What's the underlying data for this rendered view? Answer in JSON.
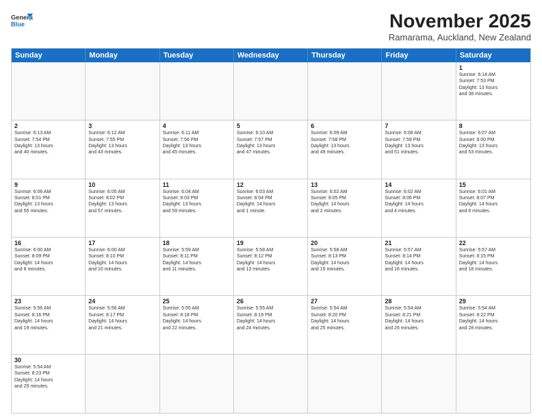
{
  "header": {
    "logo_general": "General",
    "logo_blue": "Blue",
    "month_title": "November 2025",
    "subtitle": "Ramarama, Auckland, New Zealand"
  },
  "weekdays": [
    "Sunday",
    "Monday",
    "Tuesday",
    "Wednesday",
    "Thursday",
    "Friday",
    "Saturday"
  ],
  "weeks": [
    [
      {
        "day": "",
        "text": ""
      },
      {
        "day": "",
        "text": ""
      },
      {
        "day": "",
        "text": ""
      },
      {
        "day": "",
        "text": ""
      },
      {
        "day": "",
        "text": ""
      },
      {
        "day": "",
        "text": ""
      },
      {
        "day": "1",
        "text": "Sunrise: 6:14 AM\nSunset: 7:53 PM\nDaylight: 13 hours\nand 38 minutes."
      }
    ],
    [
      {
        "day": "2",
        "text": "Sunrise: 6:13 AM\nSunset: 7:54 PM\nDaylight: 13 hours\nand 40 minutes."
      },
      {
        "day": "3",
        "text": "Sunrise: 6:12 AM\nSunset: 7:55 PM\nDaylight: 13 hours\nand 43 minutes."
      },
      {
        "day": "4",
        "text": "Sunrise: 6:11 AM\nSunset: 7:56 PM\nDaylight: 13 hours\nand 45 minutes."
      },
      {
        "day": "5",
        "text": "Sunrise: 6:10 AM\nSunset: 7:57 PM\nDaylight: 13 hours\nand 47 minutes."
      },
      {
        "day": "6",
        "text": "Sunrise: 6:09 AM\nSunset: 7:58 PM\nDaylight: 13 hours\nand 49 minutes."
      },
      {
        "day": "7",
        "text": "Sunrise: 6:08 AM\nSunset: 7:59 PM\nDaylight: 13 hours\nand 51 minutes."
      },
      {
        "day": "8",
        "text": "Sunrise: 6:07 AM\nSunset: 8:00 PM\nDaylight: 13 hours\nand 53 minutes."
      }
    ],
    [
      {
        "day": "9",
        "text": "Sunrise: 6:06 AM\nSunset: 8:01 PM\nDaylight: 13 hours\nand 55 minutes."
      },
      {
        "day": "10",
        "text": "Sunrise: 6:05 AM\nSunset: 8:02 PM\nDaylight: 13 hours\nand 57 minutes."
      },
      {
        "day": "11",
        "text": "Sunrise: 6:04 AM\nSunset: 8:03 PM\nDaylight: 13 hours\nand 59 minutes."
      },
      {
        "day": "12",
        "text": "Sunrise: 6:03 AM\nSunset: 8:04 PM\nDaylight: 14 hours\nand 1 minute."
      },
      {
        "day": "13",
        "text": "Sunrise: 6:02 AM\nSunset: 8:05 PM\nDaylight: 14 hours\nand 2 minutes."
      },
      {
        "day": "14",
        "text": "Sunrise: 6:02 AM\nSunset: 8:06 PM\nDaylight: 14 hours\nand 4 minutes."
      },
      {
        "day": "15",
        "text": "Sunrise: 6:01 AM\nSunset: 8:07 PM\nDaylight: 14 hours\nand 6 minutes."
      }
    ],
    [
      {
        "day": "16",
        "text": "Sunrise: 6:00 AM\nSunset: 8:09 PM\nDaylight: 14 hours\nand 8 minutes."
      },
      {
        "day": "17",
        "text": "Sunrise: 6:00 AM\nSunset: 8:10 PM\nDaylight: 14 hours\nand 10 minutes."
      },
      {
        "day": "18",
        "text": "Sunrise: 5:59 AM\nSunset: 8:11 PM\nDaylight: 14 hours\nand 11 minutes."
      },
      {
        "day": "19",
        "text": "Sunrise: 5:58 AM\nSunset: 8:12 PM\nDaylight: 14 hours\nand 13 minutes."
      },
      {
        "day": "20",
        "text": "Sunrise: 5:58 AM\nSunset: 8:13 PM\nDaylight: 14 hours\nand 15 minutes."
      },
      {
        "day": "21",
        "text": "Sunrise: 5:57 AM\nSunset: 8:14 PM\nDaylight: 14 hours\nand 16 minutes."
      },
      {
        "day": "22",
        "text": "Sunrise: 5:57 AM\nSunset: 8:15 PM\nDaylight: 14 hours\nand 18 minutes."
      }
    ],
    [
      {
        "day": "23",
        "text": "Sunrise: 5:56 AM\nSunset: 8:16 PM\nDaylight: 14 hours\nand 19 minutes."
      },
      {
        "day": "24",
        "text": "Sunrise: 5:56 AM\nSunset: 8:17 PM\nDaylight: 14 hours\nand 21 minutes."
      },
      {
        "day": "25",
        "text": "Sunrise: 5:55 AM\nSunset: 8:18 PM\nDaylight: 14 hours\nand 22 minutes."
      },
      {
        "day": "26",
        "text": "Sunrise: 5:55 AM\nSunset: 8:19 PM\nDaylight: 14 hours\nand 24 minutes."
      },
      {
        "day": "27",
        "text": "Sunrise: 5:54 AM\nSunset: 8:20 PM\nDaylight: 14 hours\nand 25 minutes."
      },
      {
        "day": "28",
        "text": "Sunrise: 5:54 AM\nSunset: 8:21 PM\nDaylight: 14 hours\nand 26 minutes."
      },
      {
        "day": "29",
        "text": "Sunrise: 5:54 AM\nSunset: 8:22 PM\nDaylight: 14 hours\nand 28 minutes."
      }
    ],
    [
      {
        "day": "30",
        "text": "Sunrise: 5:54 AM\nSunset: 8:23 PM\nDaylight: 14 hours\nand 29 minutes."
      },
      {
        "day": "",
        "text": ""
      },
      {
        "day": "",
        "text": ""
      },
      {
        "day": "",
        "text": ""
      },
      {
        "day": "",
        "text": ""
      },
      {
        "day": "",
        "text": ""
      },
      {
        "day": "",
        "text": ""
      }
    ]
  ]
}
